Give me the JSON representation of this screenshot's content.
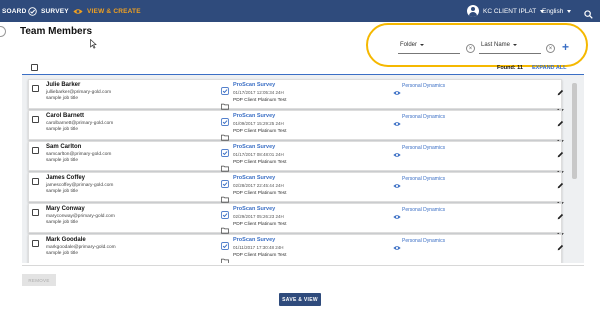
{
  "colors": {
    "nav_bg": "#2f4b7c",
    "accent": "#f0a020",
    "link": "#3b6fc5",
    "highlight": "#f5b800"
  },
  "nav": {
    "items": [
      {
        "label": "SOARD",
        "icon": "",
        "active": false
      },
      {
        "label": "SURVEY",
        "icon": "check-circle-icon",
        "active": false
      },
      {
        "label": "VIEW & CREATE",
        "icon": "eye-icon",
        "active": true
      }
    ],
    "user": "KC CLIENT IPLAT",
    "language": "English",
    "search_icon": "search-icon"
  },
  "page": {
    "title": "Team Members"
  },
  "filters": {
    "folder_label": "Folder",
    "sort_label": "Last Name",
    "clear_icon": "clear-icon",
    "add_icon": "plus-icon"
  },
  "list": {
    "found": "Found: 11",
    "expand_all": "EXPAND ALL",
    "members": [
      {
        "name": "Julie Barker",
        "email": "julliebarker@primary-gold.com",
        "job": "sample job title",
        "survey": "ProScan Survey",
        "date": "01/17/2017 12:05:34 24H",
        "folder": "PDP Client Platinum Test",
        "report": "Personal Dynamics"
      },
      {
        "name": "Carol Barnett",
        "email": "carolbarnett@primary-gold.com",
        "job": "sample job title",
        "survey": "ProScan Survey",
        "date": "01/09/2017 15:29:25 24H",
        "folder": "PDP Client Platinum Test",
        "report": "Personal Dynamics"
      },
      {
        "name": "Sam Carlton",
        "email": "samcarlton@primary-gold.com",
        "job": "sample job title",
        "survey": "ProScan Survey",
        "date": "01/17/2017 08:48:01 24H",
        "folder": "PDP Client Platinum Test",
        "report": "Personal Dynamics"
      },
      {
        "name": "James Coffey",
        "email": "jamescoffey@primary-gold.com",
        "job": "sample job title",
        "survey": "ProScan Survey",
        "date": "02/28/2017 22:45:44 24H",
        "folder": "PDP Client Platinum Test",
        "report": "Personal Dynamics"
      },
      {
        "name": "Mary Conway",
        "email": "maryconway@primary-gold.com",
        "job": "sample job title",
        "survey": "ProScan Survey",
        "date": "02/29/2017 05:26:23 24H",
        "folder": "PDP Client Platinum Test",
        "report": "Personal Dynamics"
      },
      {
        "name": "Mark Goodale",
        "email": "markgoodale@primary-gold.com",
        "job": "sample job title",
        "survey": "ProScan Survey",
        "date": "01/11/2017 17:30:48 24H",
        "folder": "PDP Client Platinum Test",
        "report": "Personal Dynamics"
      }
    ]
  },
  "actions": {
    "remove": "REMOVE",
    "save_view": "SAVE & VIEW"
  }
}
